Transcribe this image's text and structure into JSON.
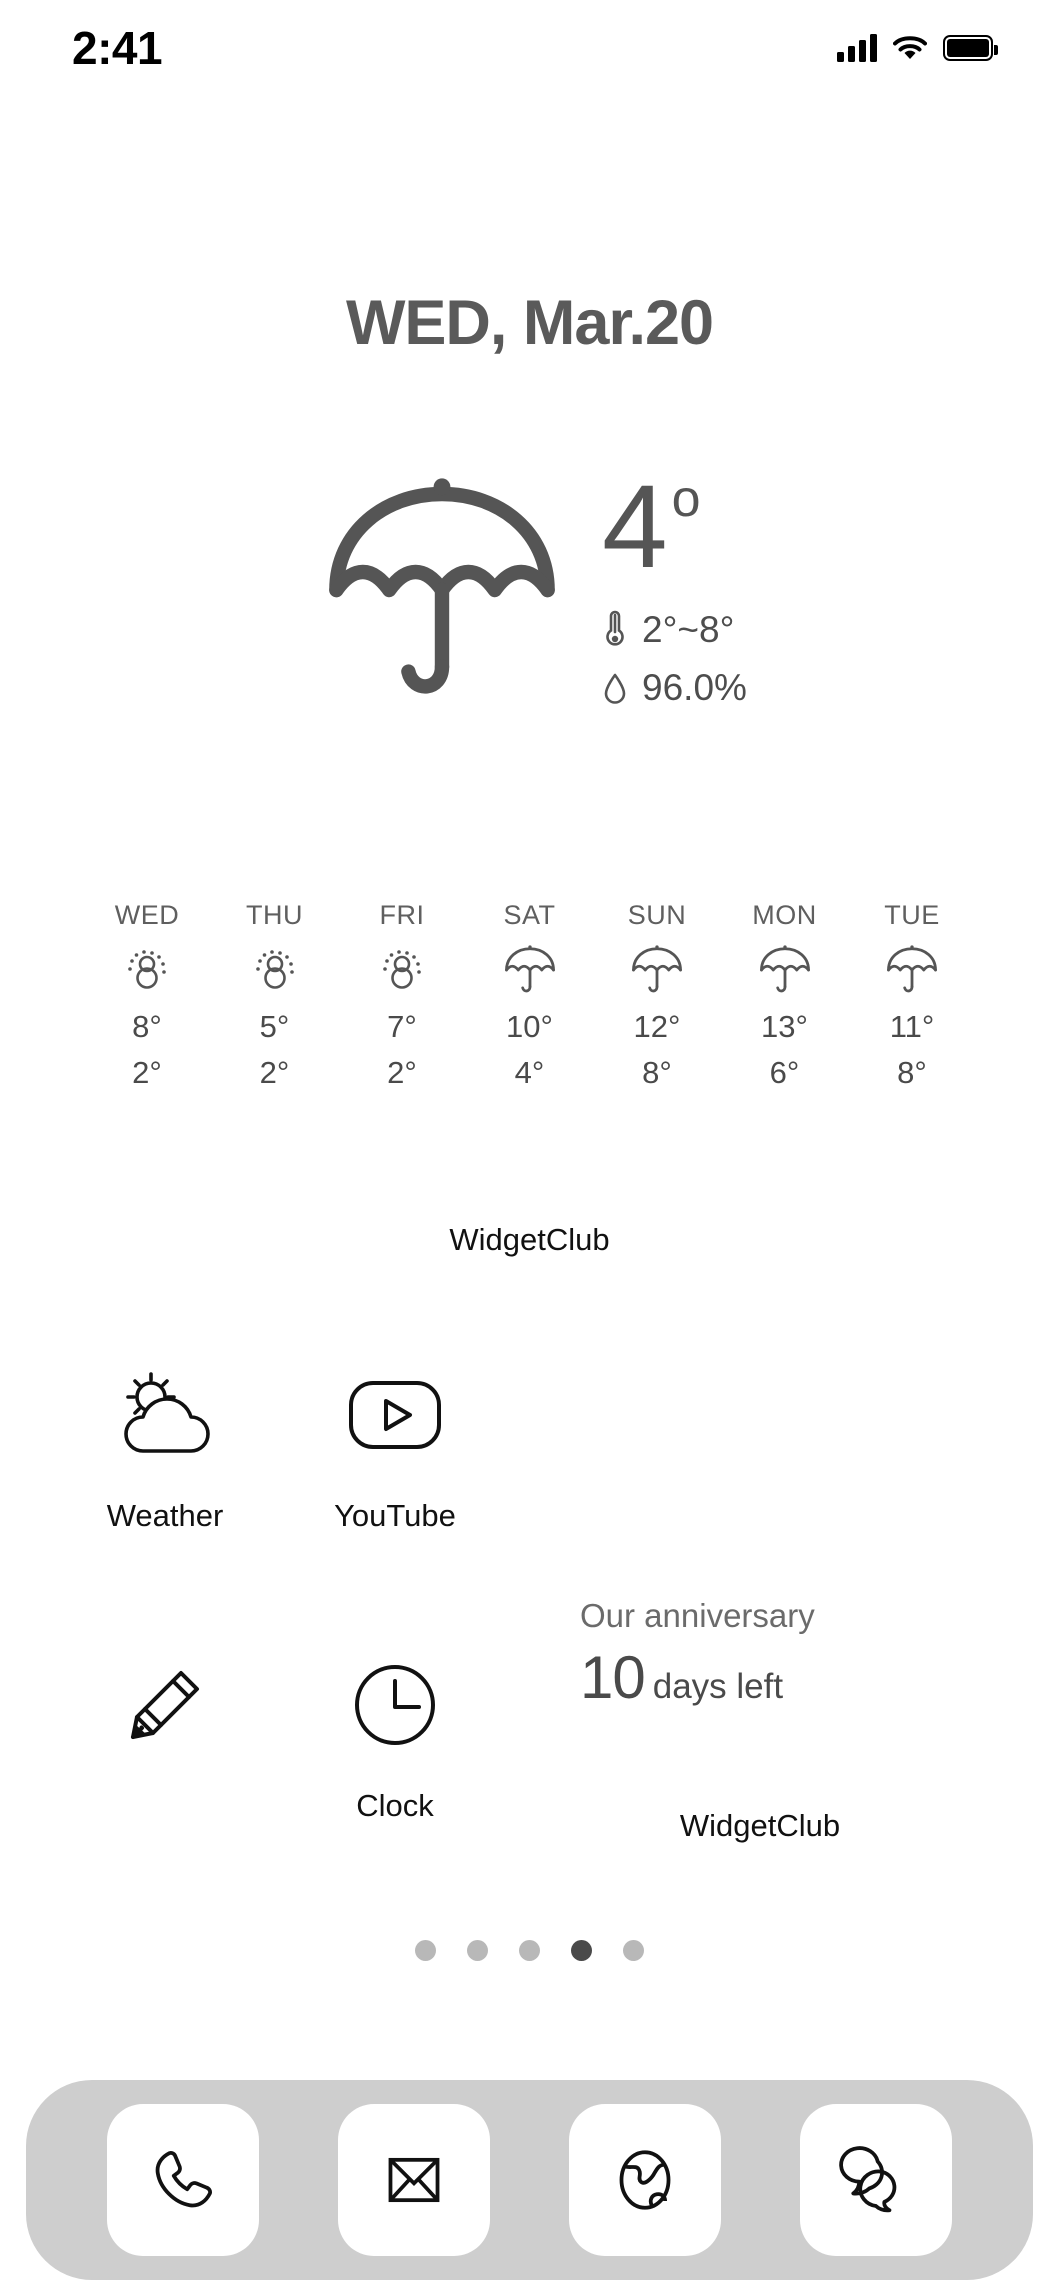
{
  "status_bar": {
    "time": "2:41",
    "signal_icon": "cellular-signal-icon",
    "wifi_icon": "wifi-icon",
    "battery_icon": "battery-full-icon"
  },
  "date_header": {
    "text": "WED, Mar.20"
  },
  "weather_widget": {
    "condition_icon": "umbrella-icon",
    "current_temp": "4",
    "degree_symbol": "o",
    "range_icon": "thermometer-icon",
    "range_text": "2°~8°",
    "humidity_icon": "water-drop-icon",
    "humidity_text": "96.0%",
    "credit": "WidgetClub",
    "forecast": [
      {
        "day": "WED",
        "icon": "snow-icon",
        "high": "8°",
        "low": "2°"
      },
      {
        "day": "THU",
        "icon": "snow-icon",
        "high": "5°",
        "low": "2°"
      },
      {
        "day": "FRI",
        "icon": "snow-icon",
        "high": "7°",
        "low": "2°"
      },
      {
        "day": "SAT",
        "icon": "umbrella-icon",
        "high": "10°",
        "low": "4°"
      },
      {
        "day": "SUN",
        "icon": "umbrella-icon",
        "high": "12°",
        "low": "8°"
      },
      {
        "day": "MON",
        "icon": "umbrella-icon",
        "high": "13°",
        "low": "6°"
      },
      {
        "day": "TUE",
        "icon": "umbrella-icon",
        "high": "11°",
        "low": "8°"
      }
    ]
  },
  "apps": {
    "row1": [
      {
        "label": "Weather",
        "icon": "sun-behind-cloud-icon"
      },
      {
        "label": "YouTube",
        "icon": "youtube-play-icon"
      }
    ],
    "row2": [
      {
        "label": "",
        "icon": "pencil-icon"
      },
      {
        "label": "Clock",
        "icon": "clock-icon"
      }
    ]
  },
  "anniversary_widget": {
    "title": "Our anniversary",
    "days": "10",
    "unit": "days left",
    "credit": "WidgetClub"
  },
  "page_dots": {
    "count": 5,
    "active_index": 3
  },
  "dock": {
    "items": [
      {
        "icon": "phone-icon"
      },
      {
        "icon": "mail-icon"
      },
      {
        "icon": "safari-globe-icon"
      },
      {
        "icon": "messages-chat-icon"
      }
    ]
  },
  "colors": {
    "text_gray": "#555555",
    "text_black": "#111111",
    "dock_bg": "#cecece",
    "dot_inactive": "#b8b8b8",
    "dot_active": "#4a4a4a"
  }
}
